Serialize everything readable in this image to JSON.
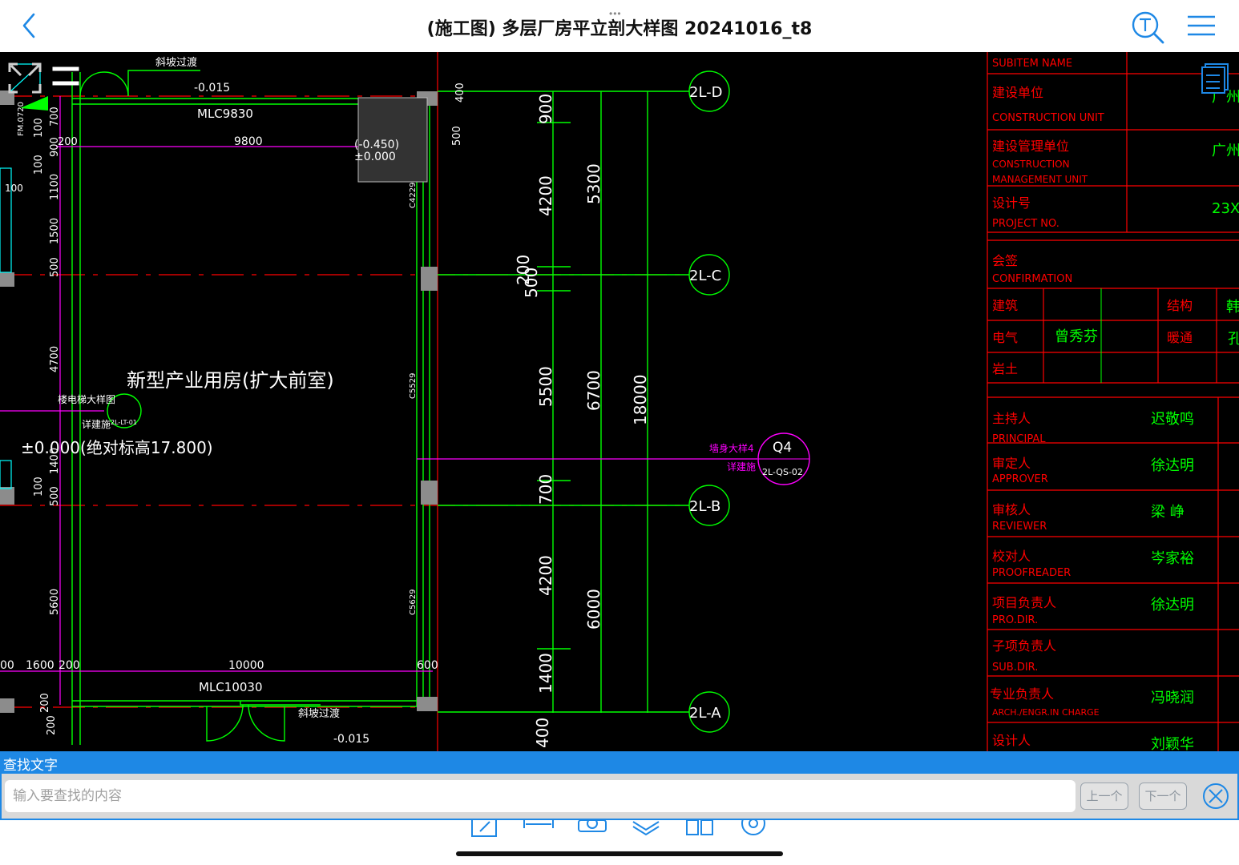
{
  "header": {
    "title": "(施工图) 多层厂房平立剖大样图 20241016_t8",
    "more_dots": "•••"
  },
  "drawing": {
    "room_name": "新型产业用房(扩大前室)",
    "elevation_main": "±0.000(绝对标高17.800)",
    "slope_top": "斜坡过渡",
    "slope_bottom": "斜坡过渡",
    "level_top": "-0.015",
    "level_bottom": "-0.015",
    "level_pit": "(-0.450)",
    "level_zero": "±0.000",
    "door_top": "MLC9830",
    "door_bottom": "MLC10030",
    "fm_label": "FM.0720",
    "dim_top_width": "9800",
    "dim_bottom_width": "10000",
    "dims_left": [
      "700",
      "100",
      "900",
      "100",
      "1100",
      "1500",
      "500",
      "4700",
      "1400",
      "100",
      "500",
      "5600"
    ],
    "dims_left_bottom": [
      "200",
      "200"
    ],
    "dim_200_top": "200",
    "dim_100_left": "100",
    "dims_bottom_row": [
      "00",
      "1600",
      "200"
    ],
    "dim_600": "600",
    "dim_400_top": "400",
    "dim_500_top": "500",
    "col_c4229": "C4229",
    "col_c5529": "C5529",
    "col_c5629": "C5629",
    "lift_detail_label": "楼电梯大样图",
    "lift_detail_ref": "详建施",
    "lift_detail_id": "2L-LT-01",
    "wall_detail_label": "墙身大样4",
    "wall_detail_ref": "详建施",
    "wall_detail_num": "Q4",
    "wall_detail_id": "2L-QS-02",
    "dims_right_col1": [
      "900",
      "4200",
      "200",
      "5500",
      "700",
      "4200",
      "1400",
      "400"
    ],
    "dim_500_mid": "500",
    "dims_right_col2": [
      "5300",
      "6700",
      "6000"
    ],
    "dim_total": "18000",
    "axes": [
      "2L-D",
      "2L-C",
      "2L-B",
      "2L-A"
    ],
    "title_block": {
      "subitem_name": "SUBITEM NAME",
      "construction_unit_cn": "建设单位",
      "construction_unit_en": "CONSTRUCTION UNIT",
      "construction_unit_val": "广州",
      "mgmt_unit_cn": "建设管理单位",
      "mgmt_unit_en1": "CONSTRUCTION",
      "mgmt_unit_en2": "MANAGEMENT UNIT",
      "mgmt_unit_val": "广州市",
      "project_no_cn": "设计号",
      "project_no_en": "PROJECT NO.",
      "project_no_val": "23X",
      "confirmation_cn": "会签",
      "confirmation_en": "CONFIRMATION",
      "sign_arch": "建筑",
      "sign_struct": "结构",
      "sign_struct_val": "韩",
      "sign_elec": "电气",
      "sign_elec_val": "曾秀芬",
      "sign_hvac": "暖通",
      "sign_hvac_val": "孔",
      "sign_geo": "岩土",
      "roles": [
        {
          "cn": "主持人",
          "en": "PRINCIPAL",
          "name": "迟敬鸣"
        },
        {
          "cn": "审定人",
          "en": "APPROVER",
          "name": "徐达明"
        },
        {
          "cn": "审核人",
          "en": "REVIEWER",
          "name": "梁 峥"
        },
        {
          "cn": "校对人",
          "en": "PROOFREADER",
          "name": "岑家裕"
        },
        {
          "cn": "项目负责人",
          "en": "PRO.DIR.",
          "name": "徐达明"
        },
        {
          "cn": "子项负责人",
          "en": "SUB.DIR.",
          "name": ""
        },
        {
          "cn": "专业负责人",
          "en": "ARCH./ENGR.IN CHARGE",
          "name": "冯晓润"
        },
        {
          "cn": "设计人",
          "en": "",
          "name": "刘颖华"
        }
      ]
    }
  },
  "find": {
    "title": "查找文字",
    "placeholder": "输入要查找的内容",
    "prev": "上一个",
    "next": "下一个"
  },
  "colors": {
    "accent": "#1e88e5",
    "cad_bg": "#000000",
    "cad_green": "#00ff00",
    "cad_magenta": "#ff00ff",
    "cad_red": "#ff0000",
    "cad_white": "#ffffff"
  }
}
